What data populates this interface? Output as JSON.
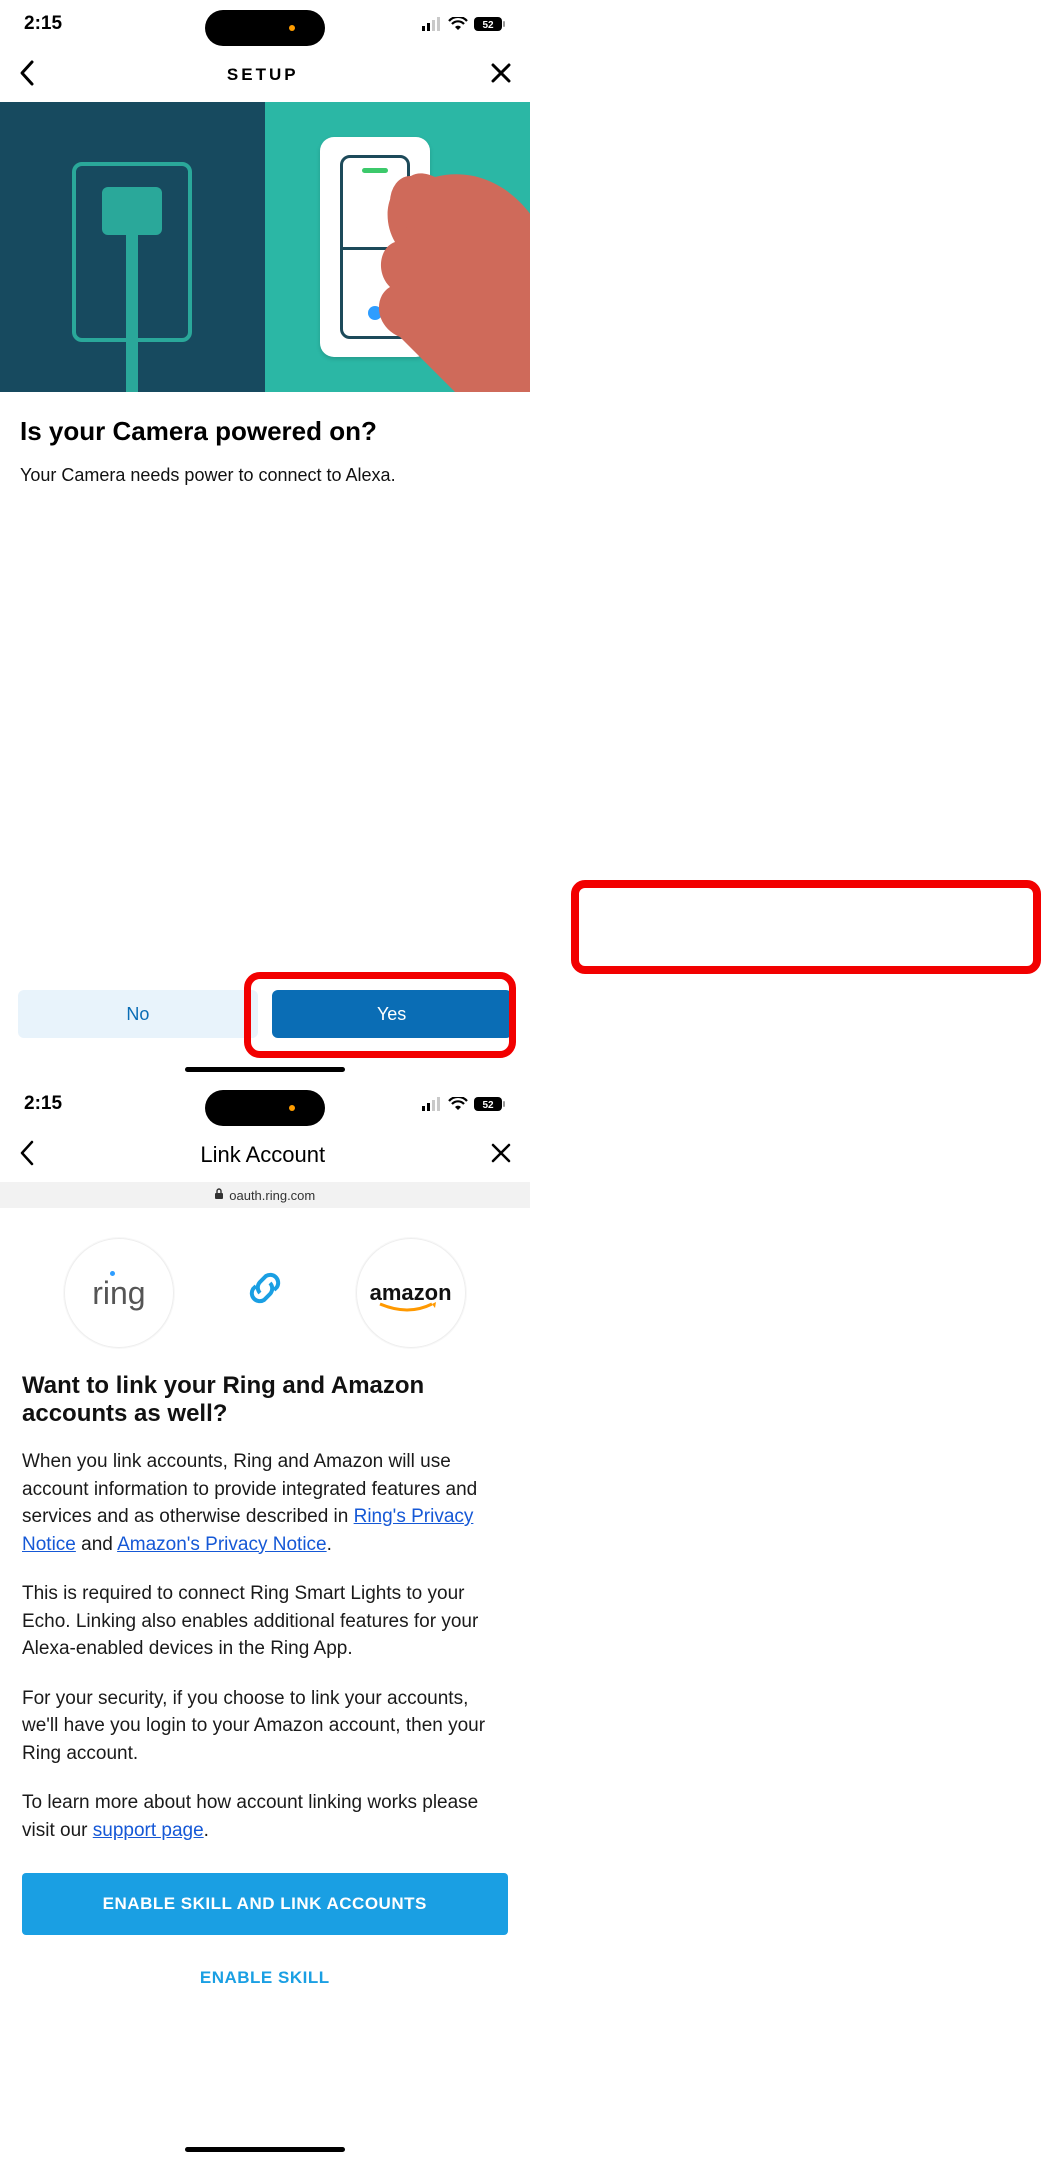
{
  "status": {
    "time": "2:15",
    "battery": "52"
  },
  "left": {
    "nav_title": "SETUP",
    "question": "Is your Camera powered on?",
    "subtext": "Your Camera needs power to connect to Alexa.",
    "btn_no": "No",
    "btn_yes": "Yes"
  },
  "right": {
    "nav_title": "Link Account",
    "url": "oauth.ring.com",
    "logo_ring": "ring",
    "logo_amazon": "amazon",
    "heading": "Want to link your Ring and Amazon accounts as well?",
    "p1_a": "When you link accounts, Ring and Amazon will use account information to provide integrated features and services and as otherwise described in ",
    "link_ring_privacy": "Ring's Privacy Notice",
    "p1_b": " and ",
    "link_amazon_privacy": "Amazon's Privacy Notice",
    "p1_c": ".",
    "p2": "This is required to connect Ring Smart Lights to your Echo. Linking also enables additional features for your Alexa-enabled devices in the Ring App.",
    "p3": "For your security, if you choose to link your accounts, we'll have you login to your Amazon account, then your Ring account.",
    "p4_a": "To learn more about how account linking works please visit our ",
    "link_support": "support page",
    "p4_b": ".",
    "btn_enable_link": "ENABLE SKILL AND LINK ACCOUNTS",
    "btn_enable_skill": "ENABLE SKILL"
  }
}
